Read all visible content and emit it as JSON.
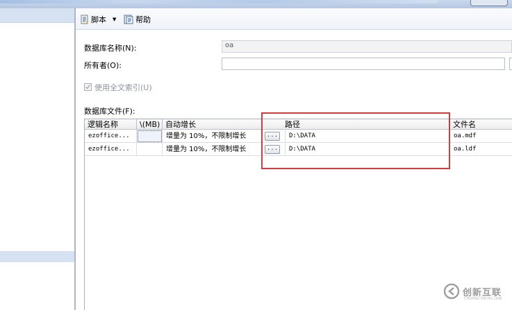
{
  "toolbar": {
    "script_label": "脚本",
    "script_dropdown": "▼",
    "help_label": "帮助"
  },
  "form": {
    "db_name_label": "数据库名称(N):",
    "db_name_value": "oa",
    "owner_label": "所有者(O):",
    "owner_value": "",
    "fulltext_label": "使用全文索引(U)",
    "files_label": "数据库文件(F):"
  },
  "grid": {
    "columns": [
      "逻辑名称",
      "\\(MB)",
      "自动增长",
      "路径",
      "文件名"
    ],
    "rows": [
      {
        "logical_name": "ezoffice...",
        "size": "",
        "autogrowth": "增量为 10%，不限制增长",
        "path": "D:\\DATA",
        "file_name": "oa.mdf"
      },
      {
        "logical_name": "ezoffice...",
        "size": "",
        "autogrowth": "增量为 10%，不限制增长",
        "path": "D:\\DATA",
        "file_name": "oa.ldf"
      }
    ],
    "browse_label": "..."
  },
  "watermark": {
    "brand": "创新互联",
    "sub": "CHUANG XIN HU LIAN"
  },
  "colors": {
    "highlight_box": "#d63a3a",
    "header_blue": "#d6e2f2"
  }
}
